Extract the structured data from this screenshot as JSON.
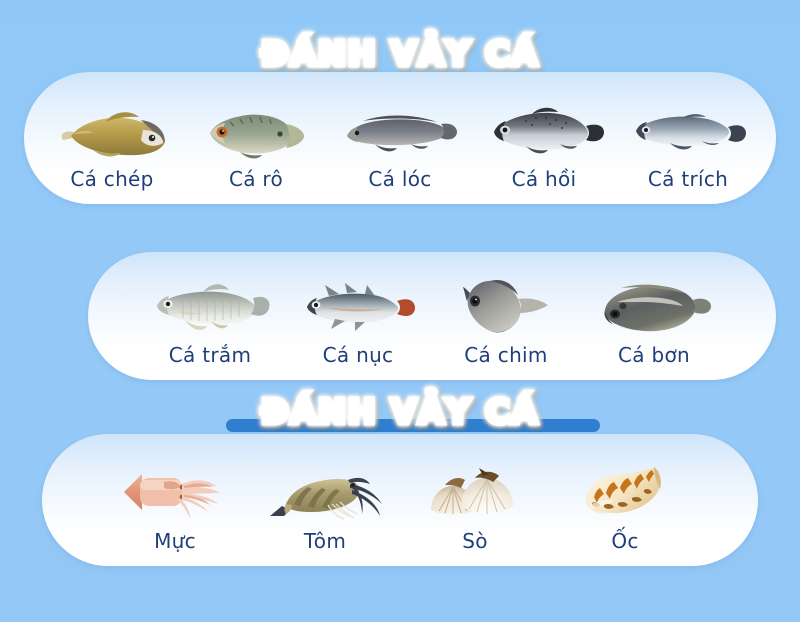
{
  "page": {
    "background_color": "#92c7f7",
    "title_gradient_top": "#ffcd6a",
    "title_gradient_bottom": "#e97f0d",
    "caption_color": "#1f3f7a",
    "bar_color": "#2f7ed0"
  },
  "sections": [
    {
      "heading": "ĐÁNH VẢY CÁ",
      "has_bar": false,
      "items": [
        {
          "label": "Cá chép",
          "icon": "carp-fish-icon"
        },
        {
          "label": "Cá rô",
          "icon": "climbing-perch-fish-icon"
        },
        {
          "label": "Cá lóc",
          "icon": "snakehead-fish-icon"
        },
        {
          "label": "Cá hồi",
          "icon": "salmon-fish-icon"
        },
        {
          "label": "Cá trích",
          "icon": "herring-fish-icon"
        }
      ]
    },
    {
      "heading": "",
      "has_bar": false,
      "items": [
        {
          "label": "Cá trắm",
          "icon": "grass-carp-fish-icon"
        },
        {
          "label": "Cá nục",
          "icon": "scad-fish-icon"
        },
        {
          "label": "Cá chim",
          "icon": "pomfret-fish-icon"
        },
        {
          "label": "Cá bơn",
          "icon": "flounder-fish-icon"
        }
      ]
    },
    {
      "heading": "ĐÁNH VẢY CÁ",
      "has_bar": true,
      "items": [
        {
          "label": "Mực",
          "icon": "squid-icon"
        },
        {
          "label": "Tôm",
          "icon": "shrimp-icon"
        },
        {
          "label": "Sò",
          "icon": "scallop-shell-icon"
        },
        {
          "label": "Ốc",
          "icon": "conch-snail-icon"
        }
      ]
    }
  ]
}
